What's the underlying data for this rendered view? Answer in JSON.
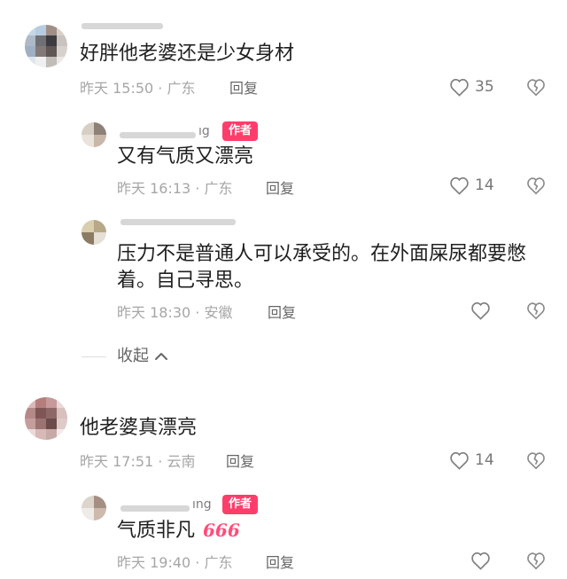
{
  "comments": [
    {
      "text": "好胖他老婆还是少女身材",
      "time": "昨天 15:50",
      "location": "广东",
      "reply_label": "回复",
      "likes": "35"
    },
    {
      "username_tail": "ıg",
      "badge": "作者",
      "text": "又有气质又漂亮",
      "time": "昨天 16:13",
      "location": "广东",
      "reply_label": "回复",
      "likes": "14"
    },
    {
      "text": "压力不是普通人可以承受的。在外面屎尿都要憋着。自己寻思。",
      "time": "昨天 18:30",
      "location": "安徽",
      "reply_label": "回复"
    },
    {
      "text": "他老婆真漂亮",
      "time": "昨天 17:51",
      "location": "云南",
      "reply_label": "回复",
      "likes": "14"
    },
    {
      "username_tail": "ıng",
      "badge": "作者",
      "text": "气质非凡",
      "emoji": "666",
      "time": "昨天 19:40",
      "location": "广东",
      "reply_label": "回复"
    }
  ],
  "collapse": {
    "label": "收起",
    "icon": "chevron-up-icon"
  },
  "icons": {
    "like": "heart-outline-icon",
    "dislike": "broken-heart-outline-icon"
  },
  "colors": {
    "author_badge": "#ff3d6b",
    "text": "#1f1f1f",
    "meta": "#a6a6a6"
  }
}
